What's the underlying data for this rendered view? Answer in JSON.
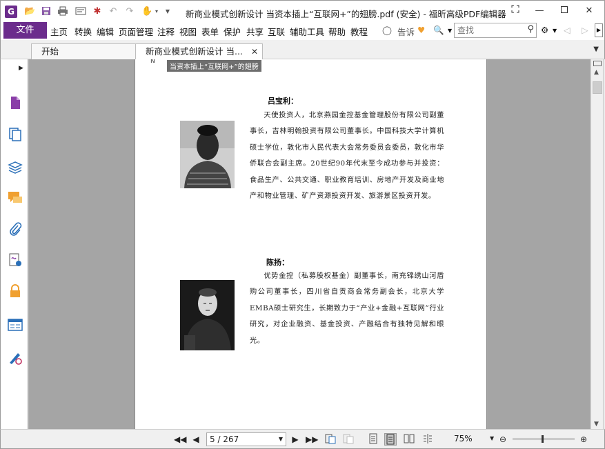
{
  "app": {
    "logo_letter": "G",
    "window_title": "新商业模式创新设计  当资本插上“互联网+”的翅膀.pdf (安全) - 福昕高级PDF编辑器"
  },
  "menu": {
    "file_label": "文件",
    "items": [
      "主页",
      "转换",
      "编辑",
      "页面管理",
      "注释",
      "视图",
      "表单",
      "保护",
      "共享",
      "互联",
      "辅助工具",
      "帮助",
      "教程"
    ],
    "tell_me": "告诉",
    "search_placeholder": "查找"
  },
  "tabs": [
    {
      "label": "开始"
    },
    {
      "label": "新商业模式创新设计  当..."
    }
  ],
  "document": {
    "tooltip": "当资本插上“互联网+”的翅膀",
    "page_mark": "N",
    "people": [
      {
        "name": "吕宝利：",
        "bio": "天使投资人，北京燕园金控基金管理股份有限公司副董事长，吉林明翰投资有限公司董事长。中国科技大学计算机硕士学位，敦化市人民代表大会常务委员会委员，敦化市华侨联合会副主席。20世纪90年代末至今成功参与并投资：食品生产、公共交通、职业教育培训、房地产开发及商业地产和物业管理、矿产资源投资开发、旅游景区投资开发。"
      },
      {
        "name": "陈扬：",
        "bio": "优势金控（私募股权基金）副董事长，南充锦绣山河盾购公司董事长，四川省自贡商会常务副会长，北京大学EMBA硕士研究生，长期致力于“产业+金融+互联网”行业研究，对企业融资、基金投资、产融结合有独特见解和眼光。"
      }
    ]
  },
  "status": {
    "current_page": "5 / 267",
    "zoom": "75%",
    "zoom_level_fraction": 0.48
  },
  "colors": {
    "brand": "#6b2c8c",
    "doc_background": "#a5a5a5"
  },
  "icons": {
    "sidebar": [
      "pages-icon",
      "thumbnails-icon",
      "layers-icon",
      "comments-icon",
      "attachments-icon",
      "signatures-icon",
      "security-icon",
      "form-fields-icon",
      "certificate-icon"
    ]
  }
}
